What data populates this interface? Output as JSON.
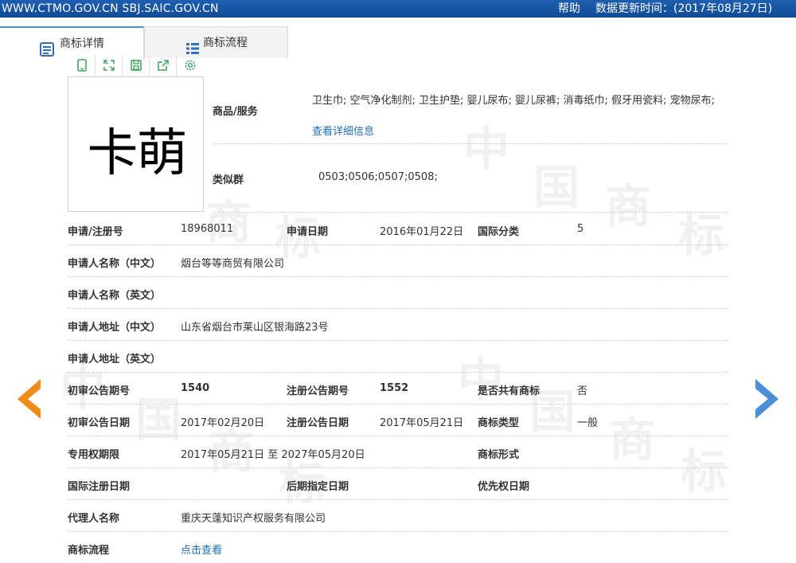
{
  "topbar": {
    "sites": "WWW.CTMO.GOV.CN SBJ.SAIC.GOV.CN",
    "help": "帮助",
    "update": "数据更新时间：(2017年08月27日)"
  },
  "tabs": [
    {
      "label": "商标详情",
      "icon": "document-list-icon"
    },
    {
      "label": "商标流程",
      "icon": "grid-list-icon"
    }
  ],
  "trademark": {
    "text": "卡萌"
  },
  "goods": {
    "label": "商品/服务",
    "items": "卫生巾; 空气净化制剂; 卫生护垫; 婴儿尿布; 婴儿尿裤; 消毒纸巾; 假牙用瓷料; 宠物尿布;",
    "detail_link": "查看详细信息"
  },
  "similar_group": {
    "label": "类似群",
    "value": "0503;0506;0507;0508;"
  },
  "fields": {
    "reg_no": {
      "label": "申请/注册号",
      "value": "18968011"
    },
    "apply_date": {
      "label": "申请日期",
      "value": "2016年01月22日"
    },
    "intl_class": {
      "label": "国际分类",
      "value": "5"
    },
    "applicant_cn": {
      "label": "申请人名称（中文）",
      "value": "烟台等等商贸有限公司"
    },
    "applicant_en": {
      "label": "申请人名称（英文）",
      "value": ""
    },
    "address_cn": {
      "label": "申请人地址（中文）",
      "value": "山东省烟台市莱山区银海路23号"
    },
    "address_en": {
      "label": "申请人地址（英文）",
      "value": ""
    },
    "prelim_no": {
      "label": "初审公告期号",
      "value": "1540"
    },
    "reg_notice_no": {
      "label": "注册公告期号",
      "value": "1552"
    },
    "shared": {
      "label": "是否共有商标",
      "value": "否"
    },
    "prelim_date": {
      "label": "初审公告日期",
      "value": "2017年02月20日"
    },
    "reg_notice_date": {
      "label": "注册公告日期",
      "value": "2017年05月21日"
    },
    "mark_type": {
      "label": "商标类型",
      "value": "一般"
    },
    "term": {
      "label": "专用权期限",
      "value": "2017年05月21日 至 2027年05月20日"
    },
    "mark_form": {
      "label": "商标形式",
      "value": ""
    },
    "intl_reg_date": {
      "label": "国际注册日期",
      "value": ""
    },
    "later_date": {
      "label": "后期指定日期",
      "value": ""
    },
    "priority_date": {
      "label": "优先权日期",
      "value": ""
    },
    "agent": {
      "label": "代理人名称",
      "value": "重庆天蓬知识产权服务有限公司"
    },
    "flow": {
      "label": "商标流程",
      "value": "点击查看"
    }
  },
  "colors": {
    "topbar": "#1f5fb0",
    "link": "#1f6fb8",
    "prev_arrow": "#f08c1a",
    "next_arrow": "#4a8fd8"
  }
}
